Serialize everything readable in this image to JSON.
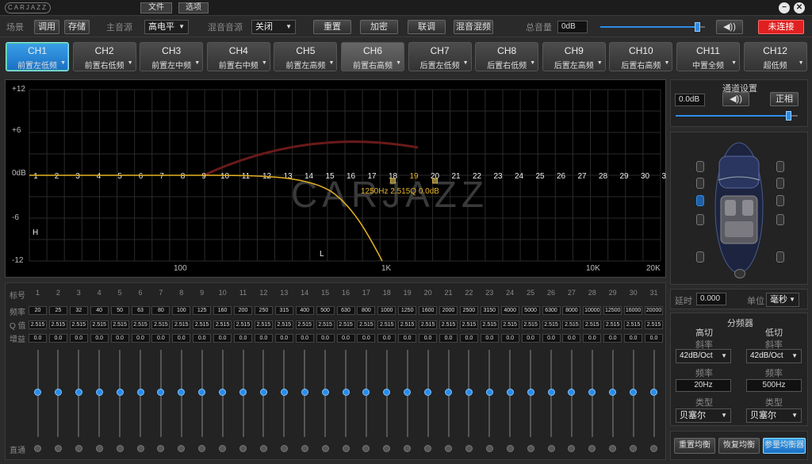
{
  "menubar": {
    "logo": "CARJAZZ",
    "file": "文件",
    "options": "选项",
    "minimize": "−",
    "close": "✕"
  },
  "toolbar": {
    "scene_label": "场景",
    "call": "调用",
    "store": "存储",
    "main_source_label": "主音源",
    "main_source_value": "高电平",
    "mix_source_label": "混音音源",
    "mix_source_value": "关闭",
    "reset": "重置",
    "encrypt": "加密",
    "link": "联调",
    "mix_freq": "混音混频",
    "master_volume_label": "总音量",
    "master_volume_value": "0dB",
    "master_volume_level": 0.93,
    "connection": "未连接"
  },
  "channels": [
    {
      "name": "CH1",
      "sub": "前置左低频"
    },
    {
      "name": "CH2",
      "sub": "前置右低频"
    },
    {
      "name": "CH3",
      "sub": "前置左中频"
    },
    {
      "name": "CH4",
      "sub": "前置右中频"
    },
    {
      "name": "CH5",
      "sub": "前置左高频"
    },
    {
      "name": "CH6",
      "sub": "前置右高频"
    },
    {
      "name": "CH7",
      "sub": "后置左低频"
    },
    {
      "name": "CH8",
      "sub": "后置右低频"
    },
    {
      "name": "CH9",
      "sub": "后置左高频"
    },
    {
      "name": "CH10",
      "sub": "后置右高频"
    },
    {
      "name": "CH11",
      "sub": "中置全频"
    },
    {
      "name": "CH12",
      "sub": "超低频"
    }
  ],
  "graph": {
    "y_labels": [
      "+12",
      "+6",
      "0dB",
      "-6",
      "-12"
    ],
    "x_labels": [
      "100",
      "1K",
      "10K",
      "20K"
    ],
    "readout": "1250Hz 2.515Q 0.0dB",
    "marker_h": "H",
    "marker_l": "L",
    "watermark": "CARJAZZ",
    "selected_band": 19,
    "highlight_band": 20
  },
  "eq": {
    "index_label": "标号",
    "freq_label": "频率",
    "q_label": "Q 值",
    "gain_label": "增益",
    "bypass_label": "直通",
    "bands": [
      "1",
      "2",
      "3",
      "4",
      "5",
      "6",
      "7",
      "8",
      "9",
      "10",
      "11",
      "12",
      "13",
      "14",
      "15",
      "16",
      "17",
      "18",
      "19",
      "20",
      "21",
      "22",
      "23",
      "24",
      "25",
      "26",
      "27",
      "28",
      "29",
      "30",
      "31"
    ],
    "freqs": [
      "20",
      "25",
      "32",
      "40",
      "50",
      "63",
      "80",
      "100",
      "125",
      "160",
      "200",
      "250",
      "315",
      "400",
      "500",
      "630",
      "800",
      "1000",
      "1250",
      "1600",
      "2000",
      "2500",
      "3150",
      "4000",
      "5000",
      "6300",
      "8000",
      "10000",
      "12500",
      "16000",
      "20000"
    ],
    "q": "2.515",
    "gain": "0.0"
  },
  "channel_settings": {
    "title": "通道设置",
    "gain": "0.0dB",
    "mute": "◀))",
    "phase": "正相",
    "level": 0.93
  },
  "delay": {
    "label": "延时",
    "value": "0.000",
    "unit_label": "单位",
    "unit_value": "毫秒"
  },
  "crossover": {
    "title": "分频器",
    "hp_title": "高切",
    "lp_title": "低切",
    "slope_label": "斜率",
    "hp_slope": "42dB/Oct",
    "lp_slope": "42dB/Oct",
    "freq_label": "频率",
    "hp_freq": "20Hz",
    "lp_freq": "500Hz",
    "type_label": "类型",
    "hp_type": "贝塞尔",
    "lp_type": "贝塞尔"
  },
  "footer": {
    "reset_eq": "重置均衡",
    "restore_eq": "恢复均衡",
    "param_eq": "参量均衡器"
  },
  "colors": {
    "accent": "#1f8ae0",
    "curve": "#e6b422",
    "danger": "#e02020"
  }
}
